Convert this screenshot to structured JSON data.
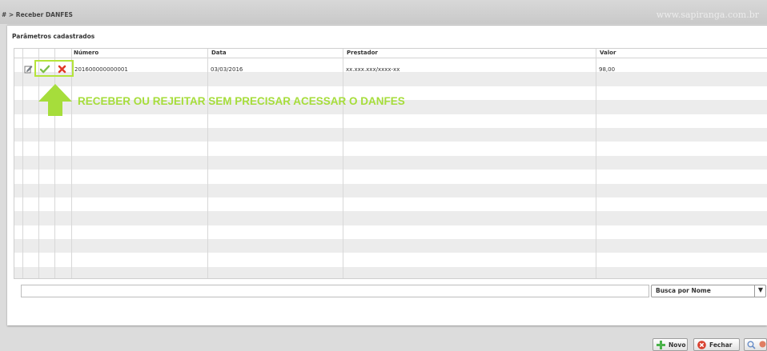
{
  "breadcrumb": "# > Receber DANFES",
  "watermark": "www.sapiranga.com.br",
  "panel": {
    "title": "Parâmetros cadastrados"
  },
  "table": {
    "columns": [
      "Número",
      "Data",
      "Prestador",
      "Valor"
    ],
    "rows": [
      {
        "numero": "201600000000001",
        "data": "03/03/2016",
        "prestador": "xx.xxx.xxx/xxxx-xx",
        "valor": "98,00"
      }
    ]
  },
  "annotation": "RECEBER OU REJEITAR SEM PRECISAR ACESSAR O DANFES",
  "search": {
    "value": "",
    "select_label": "Busca por Nome"
  },
  "buttons": {
    "novo": "Novo",
    "fechar": "Fechar"
  },
  "colors": {
    "accent": "#a6dd3b",
    "approve": "#7ec04a",
    "reject": "#e03a2a"
  },
  "icons": [
    "edit-icon",
    "check-icon",
    "reject-icon",
    "arrow-up-icon",
    "plus-icon",
    "close-icon",
    "chevron-down-icon"
  ]
}
